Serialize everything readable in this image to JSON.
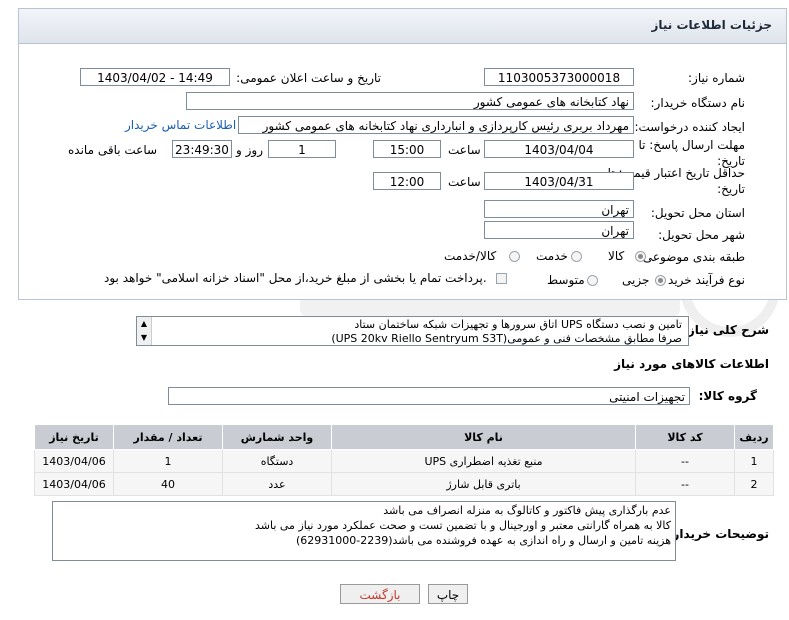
{
  "page_title": "جزئیات اطلاعات نیاز",
  "fields": {
    "need_number_label": "شماره نیاز:",
    "need_number": "1103005373000018",
    "announce_label": "تاریخ و ساعت اعلان عمومی:",
    "announce_value": "1403/04/02 - 14:49",
    "buyer_org_label": "نام دستگاه خریدار:",
    "buyer_org": "نهاد کتابخانه های عمومی کشور",
    "requester_label": "ایجاد کننده درخواست:",
    "requester": "مهرداد بربری رئیس کارپردازی و انبارداری نهاد کتابخانه های عمومی کشور",
    "contact_link": "اطلاعات تماس خریدار",
    "deadline_label_1": "مهلت ارسال پاسخ: تا",
    "deadline_label_2": "تاریخ:",
    "deadline_date": "1403/04/04",
    "time_label": "ساعت",
    "deadline_time": "15:00",
    "days_value": "1",
    "days_label": "روز و",
    "remaining_time": "23:49:30",
    "remaining_label": "ساعت باقی مانده",
    "validity_label_1": "حداقل تاریخ اعتبار قیمت: تا",
    "validity_label_2": "تاریخ:",
    "validity_date": "1403/04/31",
    "validity_time": "12:00",
    "province_label": "استان محل تحویل:",
    "province": "تهران",
    "city_label": "شهر محل تحویل:",
    "city": "تهران",
    "category_label": "طبقه بندی موضوعی:",
    "category_options": [
      "کالا",
      "خدمت",
      "کالا/خدمت"
    ],
    "category_selected": "کالا",
    "process_label": "نوع فرآیند خرید :",
    "process_options": [
      "جزیی",
      "متوسط"
    ],
    "process_selected": "جزیی",
    "payment_note": "پرداخت تمام یا بخشی از مبلغ خرید،از محل \"اسناد خزانه اسلامی\" خواهد بود."
  },
  "description": {
    "label": "شرح کلی نیاز:",
    "line1": "تامین و نصب دستگاه UPS اتاق سرورها و تجهیزات شبکه ساختمان ستاد",
    "line2": "صرفا مطابق مشخصات فنی و عمومی(UPS 20kv Riello Sentryum S3T)"
  },
  "goods_section_title": "اطلاعات کالاهای مورد نیاز",
  "goods_group_label": "گروه کالا:",
  "goods_group": "تجهیزات امنیتی",
  "table": {
    "headers": [
      "ردیف",
      "کد کالا",
      "نام کالا",
      "واحد شمارش",
      "تعداد / مقدار",
      "تاریخ نیاز"
    ],
    "rows": [
      [
        "1",
        "--",
        "منبع تغذیه اضطراری UPS",
        "دستگاه",
        "1",
        "1403/04/06"
      ],
      [
        "2",
        "--",
        "باتری قابل شارژ",
        "عدد",
        "40",
        "1403/04/06"
      ]
    ]
  },
  "buyer_notes": {
    "label": "توضیحات خریدار:",
    "line1": "عدم بارگذاری پیش فاکتور و کاتالوگ به منزله انصراف می باشد",
    "line2": "کالا به همراه گارانتی معتبر و اورجینال و با تضمین تست و صحت عملکرد مورد نیاز می باشد",
    "line3": "هزینه تامین و ارسال و راه اندازی به عهده فروشنده می باشد(2239-62931000)"
  },
  "buttons": {
    "print": "چاپ",
    "back": "بازگشت"
  },
  "colors": {
    "title_bg": "#dfe4ec",
    "table_header": "#c9cdd3",
    "link": "#1a5fb4",
    "back_text": "#c0392b"
  }
}
